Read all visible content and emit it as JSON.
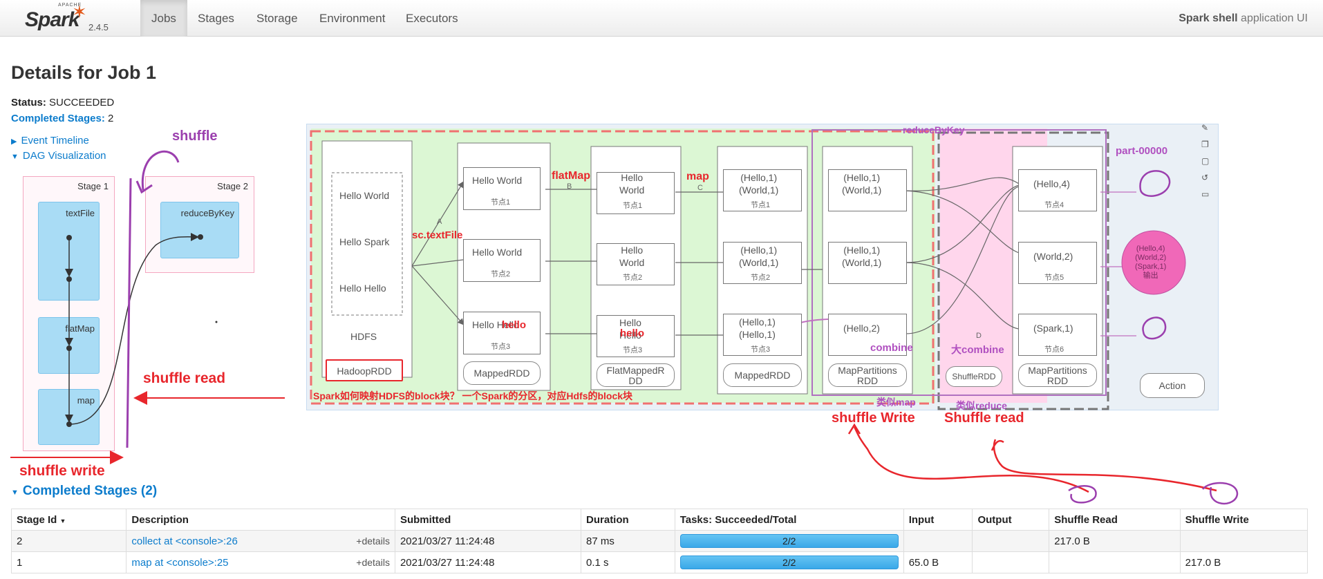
{
  "nav": {
    "apache": "APACHE",
    "brand": "Spark",
    "version": "2.4.5",
    "tabs": [
      "Jobs",
      "Stages",
      "Storage",
      "Environment",
      "Executors"
    ],
    "app_name": "Spark shell",
    "app_suffix": "application UI"
  },
  "page": {
    "title": "Details for Job 1",
    "status_label": "Status:",
    "status_value": "SUCCEEDED",
    "completed_label": "Completed Stages:",
    "completed_value": "2",
    "event_timeline": "Event Timeline",
    "dag_viz": "DAG Visualization"
  },
  "dag": {
    "stage1_label": "Stage 1",
    "stage2_label": "Stage 2",
    "rdds": [
      "textFile",
      "flatMap",
      "map",
      "reduceByKey"
    ]
  },
  "annotations": {
    "shuffle": "shuffle",
    "shuffle_read": "shuffle read",
    "shuffle_write": "shuffle write",
    "shuffle_write_2": "shuffle Write",
    "shuffle_read_2": "Shuffle read",
    "reduceByKey": "reduceByKey",
    "part": "part-00000",
    "flatMap": "flatMap",
    "map": "map",
    "sc_textFile": "sc.textFile",
    "hello": "hello",
    "combine": "combine",
    "big_combine": "大combine",
    "similar_map": "类似map",
    "similar_reduce": "类似reduce",
    "bottom_note": "Spark如何映射HDFS的block块？   一个Spark的分区，对应Hdfs的block块"
  },
  "diagram": {
    "hdfs_lines": [
      "Hello World",
      "Hello Spark",
      "Hello Hello"
    ],
    "hdfs": "HDFS",
    "hadoopRDD": "HadoopRDD",
    "mapped_items": [
      "Hello World",
      "Hello World",
      "Hello Hello"
    ],
    "nodes": [
      "节点1",
      "节点2",
      "节点3",
      "节点4",
      "节点5",
      "节点6"
    ],
    "mappedRDD": "MappedRDD",
    "flat_items": [
      "Hello\nWorld",
      "Hello\nWorld",
      "Hello\nHello"
    ],
    "flatMappedRDD": "FlatMappedR\nDD",
    "map_items": [
      "(Hello,1)\n(World,1)",
      "(Hello,1)\n(World,1)",
      "(Hello,1)\n(Hello,1)"
    ],
    "mappedRDD2": "MappedRDD",
    "mp_items": [
      "(Hello,1)\n(World,1)",
      "(Hello,1)\n(World,1)",
      "(Hello,2)"
    ],
    "mapPartitionsRDD": "MapPartitions\nRDD",
    "shuffleRDD": "ShuffleRDD",
    "reduce_items": [
      "(Hello,4)",
      "(World,2)",
      "(Spark,1)"
    ],
    "mapPartitionsRDD2": "MapPartitions\nRDD",
    "output": "(Hello,4)\n(World,2)\n(Spark,1)\n输出",
    "action": "Action",
    "letters": [
      "A",
      "B",
      "C",
      "D"
    ]
  },
  "table": {
    "section_title": "Completed Stages (2)",
    "headers": [
      "Stage Id",
      "Description",
      "Submitted",
      "Duration",
      "Tasks: Succeeded/Total",
      "Input",
      "Output",
      "Shuffle Read",
      "Shuffle Write"
    ],
    "details_label": "+details",
    "rows": [
      {
        "id": "2",
        "desc": "collect at <console>:26",
        "submitted": "2021/03/27 11:24:48",
        "duration": "87 ms",
        "tasks": "2/2",
        "tasks_fraction": 1.0,
        "input": "",
        "output": "",
        "shuffle_read": "217.0 B",
        "shuffle_write": ""
      },
      {
        "id": "1",
        "desc": "map at <console>:25",
        "submitted": "2021/03/27 11:24:48",
        "duration": "0.1 s",
        "tasks": "2/2",
        "tasks_fraction": 1.0,
        "input": "65.0 B",
        "output": "",
        "shuffle_read": "",
        "shuffle_write": "217.0 B"
      }
    ]
  },
  "colors": {
    "link": "#0c7ccc",
    "rdd": "#a9dcf5",
    "annot_red": "#e8262c",
    "annot_purple": "#9b3fae",
    "pink_fill": "#ffd6ec",
    "green_fill": "#dcf7d4"
  }
}
